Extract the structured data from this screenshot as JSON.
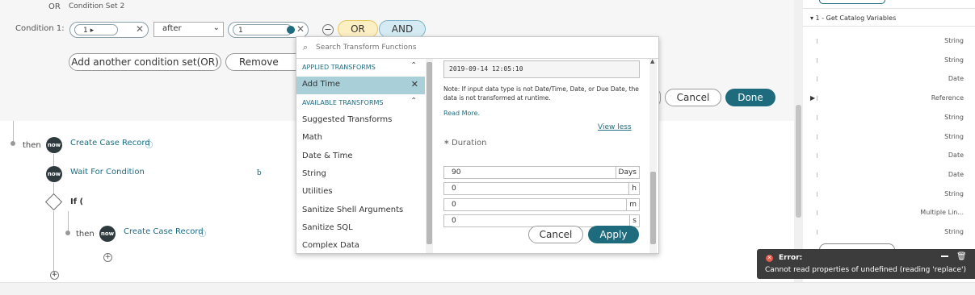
{
  "condition_set": {
    "or_label": "OR",
    "set_title": "Condition Set 2",
    "condition_label": "Condition 1:",
    "field_value": "1 ▸",
    "operator_value": "after",
    "compare_value": "1",
    "or_toggle": "OR",
    "and_toggle": "AND",
    "add_set_button": "Add another condition set(OR)",
    "remove_button": "Remove cond",
    "cancel_button": "Cancel",
    "done_button": "Done"
  },
  "flow": {
    "then_1": "then",
    "step_1": "Create Case Record",
    "step_2": "Wait For Condition",
    "if_label": "If (",
    "then_2": "then",
    "step_3": "Create Case Record",
    "now_badge": "now"
  },
  "transform": {
    "search_placeholder": "Search Transform Functions",
    "applied_heading": "APPLIED TRANSFORMS",
    "applied_item": "Add Time",
    "available_heading": "AVAILABLE TRANSFORMS",
    "available_items": [
      "Suggested Transforms",
      "Math",
      "Date & Time",
      "String",
      "Utilities",
      "Sanitize Shell Arguments",
      "Sanitize SQL",
      "Complex Data"
    ],
    "datetime_value": "2019-09-14 12:05:10",
    "note": "Note: If input data type is not Date/Time, Date, or Due Date, the data is not transformed at runtime.",
    "read_more": "Read More.",
    "view_less": "View less",
    "duration_label": "Duration",
    "duration_required": "∗",
    "fields": [
      {
        "value": "90",
        "unit": "Days"
      },
      {
        "value": "0",
        "unit": "h"
      },
      {
        "value": "0",
        "unit": "m"
      },
      {
        "value": "0",
        "unit": "s"
      }
    ],
    "cancel_button": "Cancel",
    "apply_button": "Apply"
  },
  "data_panel": {
    "section_title": "▾ 1 - Get Catalog Variables",
    "types": [
      "String",
      "String",
      "Date",
      "Reference",
      "String",
      "String",
      "Date",
      "Date",
      "String",
      "Multiple Lin...",
      "String"
    ]
  },
  "error": {
    "title": "Error:",
    "message": "Cannot read properties of undefined (reading 'replace')"
  },
  "colors": {
    "accent": "#1f6b7e",
    "or_toggle_bg": "#fcefc3",
    "and_toggle_bg": "#d4ebf3",
    "selected_row_bg": "#a9cfd9",
    "error_icon": "#e55b4d"
  }
}
